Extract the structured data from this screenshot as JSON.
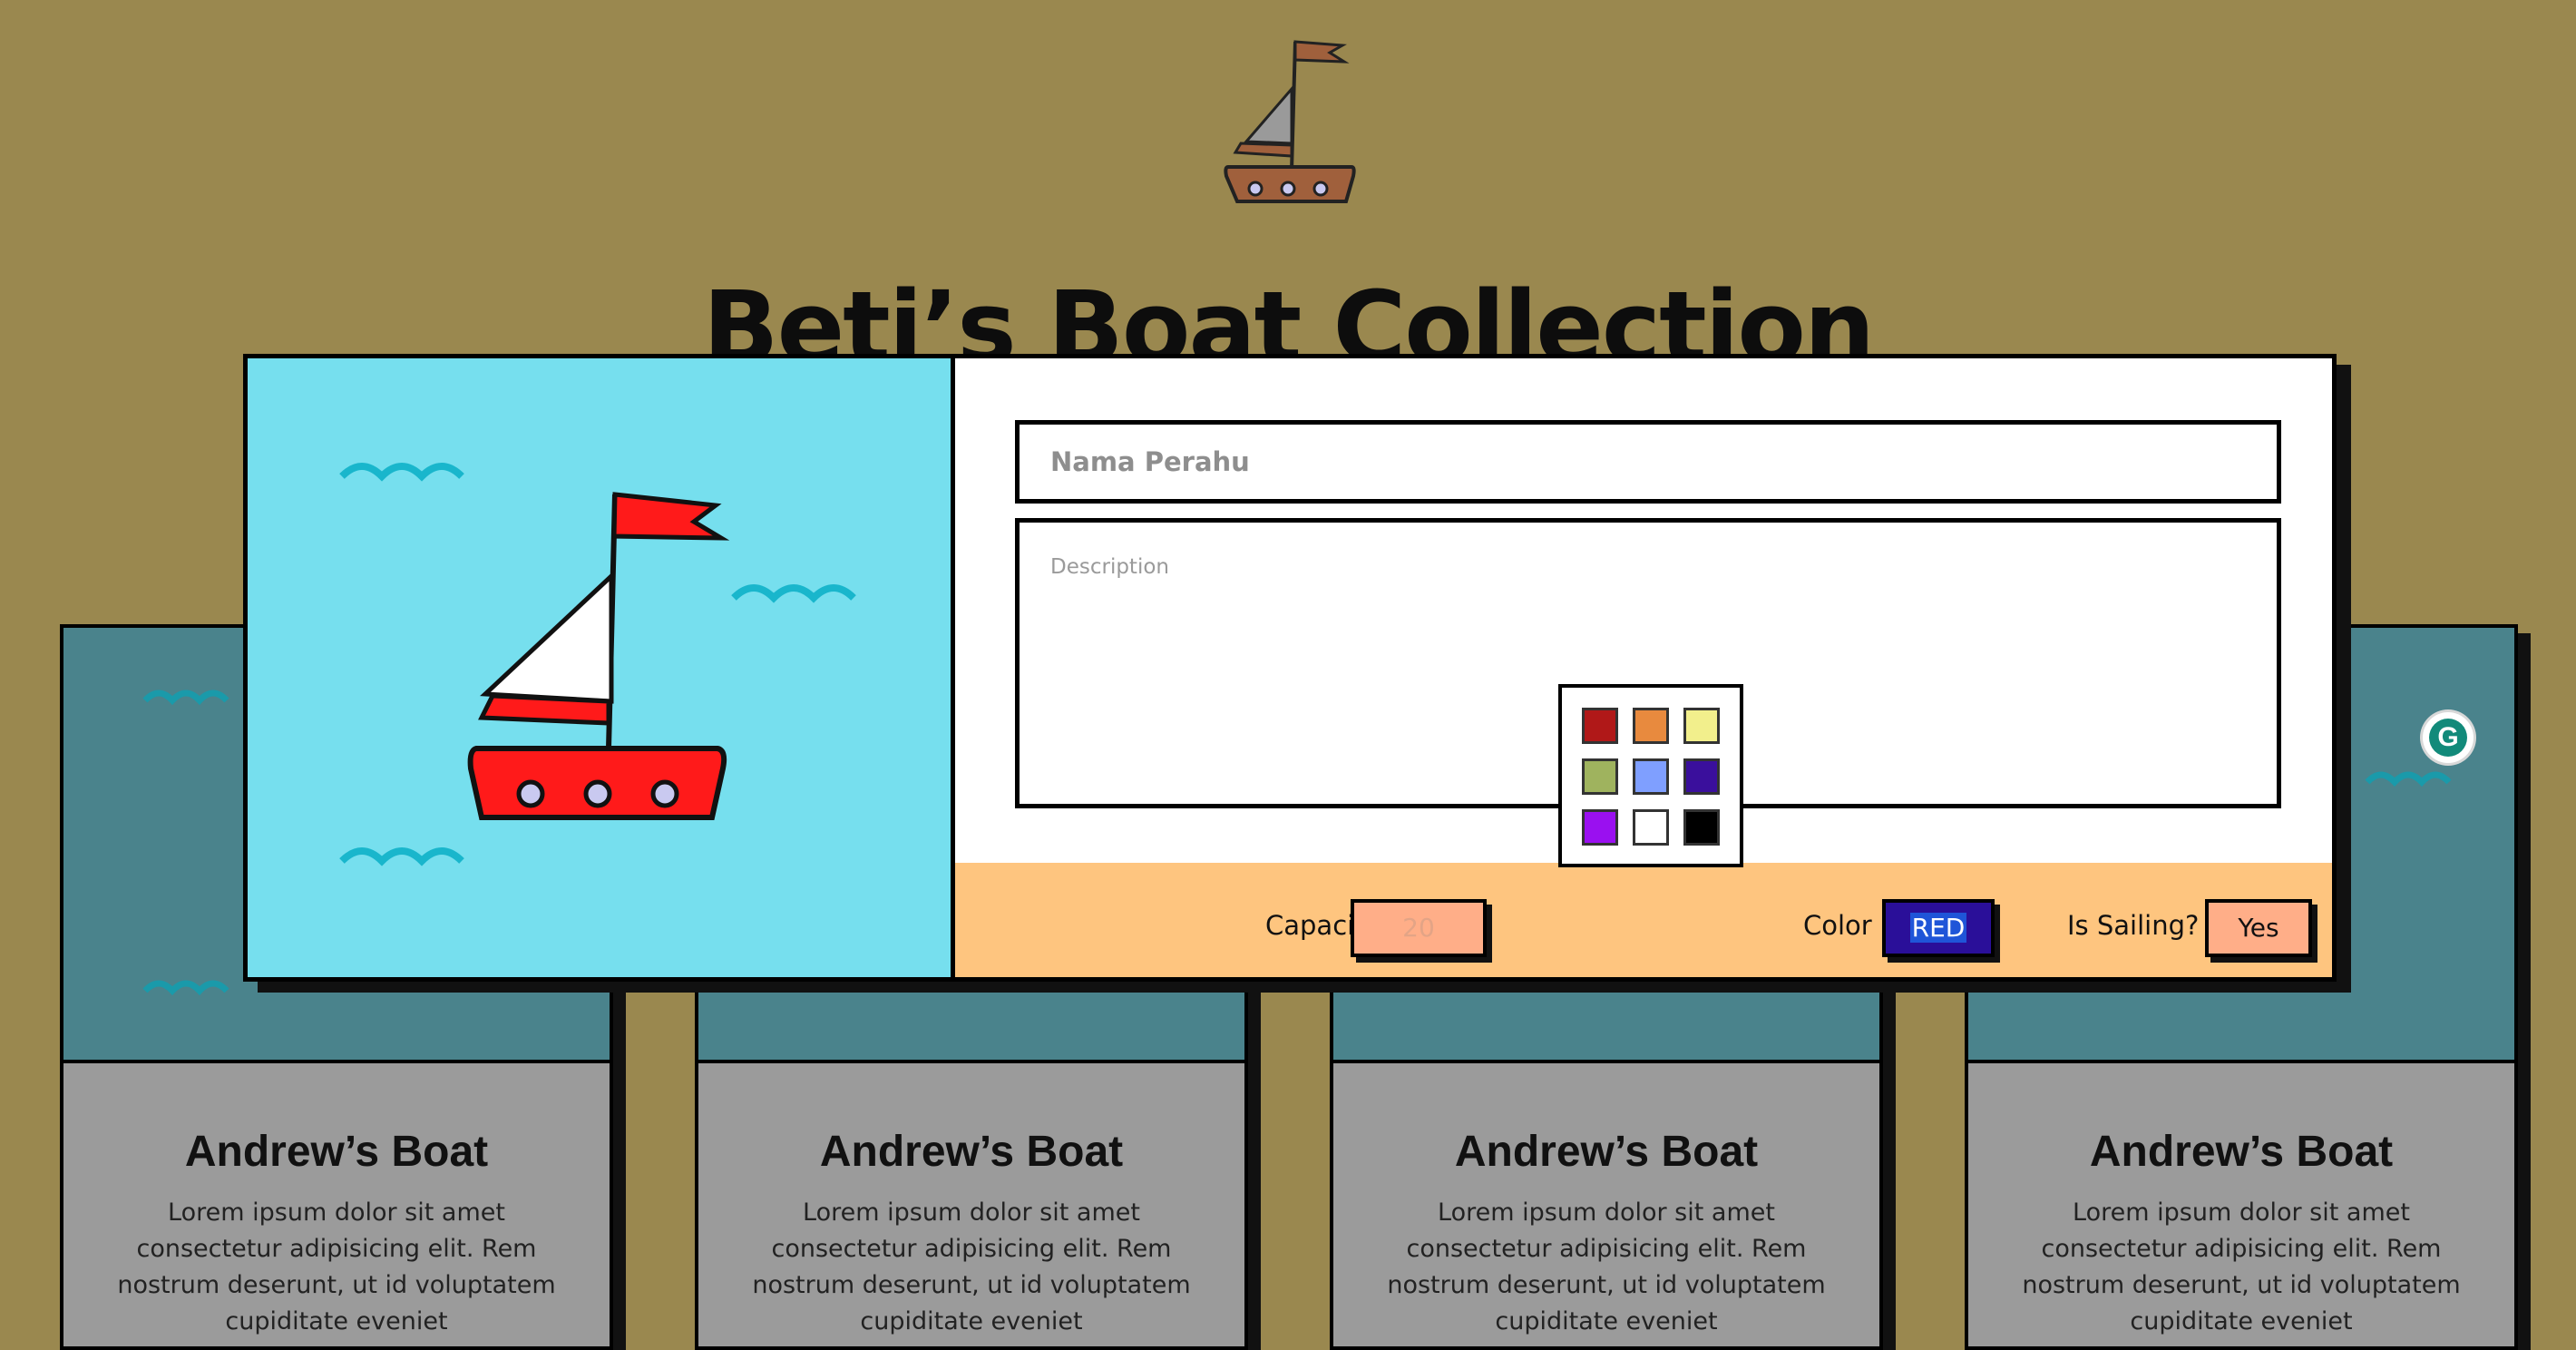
{
  "page": {
    "title": "Beti’s Boat Collection"
  },
  "cards": [
    {
      "title": "Andrew’s Boat",
      "description": "Lorem ipsum dolor sit amet consectetur adipisicing elit. Rem nostrum deserunt, ut id voluptatem cupiditate eveniet"
    },
    {
      "title": "Andrew’s Boat",
      "description": "Lorem ipsum dolor sit amet consectetur adipisicing elit. Rem nostrum deserunt, ut id voluptatem cupiditate eveniet"
    },
    {
      "title": "Andrew’s Boat",
      "description": "Lorem ipsum dolor sit amet consectetur adipisicing elit. Rem nostrum deserunt, ut id voluptatem cupiditate eveniet"
    },
    {
      "title": "Andrew’s Boat",
      "description": "Lorem ipsum dolor sit amet consectetur adipisicing elit. Rem nostrum deserunt, ut id voluptatem cupiditate eveniet"
    }
  ],
  "modal": {
    "name_placeholder": "Nama Perahu",
    "description_placeholder": "Description",
    "capacity_label": "Capacity",
    "capacity_placeholder": "20",
    "color_label": "Color",
    "color_value": "RED",
    "sailing_label": "Is Sailing?",
    "sailing_value": "Yes",
    "grammarly_icon": "G"
  },
  "colors": {
    "background": "#9a884f",
    "preview_sky": "#76dfee",
    "boat_red": "#ff1a1a",
    "bottom_bar": "#fec57f",
    "color_button": "#2a0f99",
    "field_box": "#ffae88"
  },
  "color_options": [
    {
      "name": "red",
      "hex": "#b01818"
    },
    {
      "name": "orange",
      "hex": "#e88a3e"
    },
    {
      "name": "light-yellow",
      "hex": "#f2ef8c"
    },
    {
      "name": "olive-green",
      "hex": "#9fb35e"
    },
    {
      "name": "light-blue",
      "hex": "#7f9fff"
    },
    {
      "name": "indigo",
      "hex": "#3a0f9c"
    },
    {
      "name": "purple",
      "hex": "#9a10f0"
    },
    {
      "name": "white",
      "hex": "#ffffff"
    },
    {
      "name": "black",
      "hex": "#000000"
    }
  ]
}
